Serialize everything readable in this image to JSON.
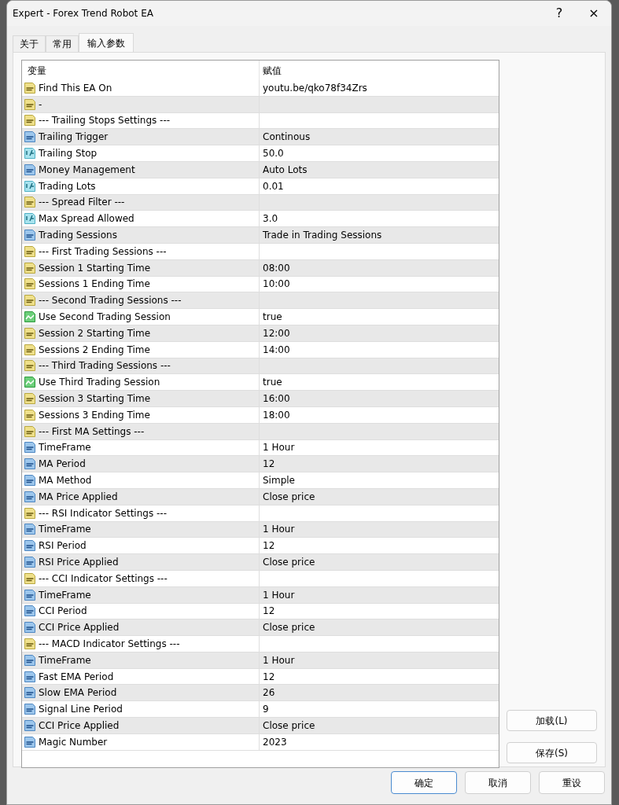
{
  "window": {
    "title": "Expert - Forex Trend Robot EA",
    "help": "?",
    "close": "×"
  },
  "tabs": [
    {
      "label": "关于",
      "selected": false
    },
    {
      "label": "常用",
      "selected": false
    },
    {
      "label": "输入参数",
      "selected": true
    }
  ],
  "table": {
    "columns": [
      "变量",
      "赋值"
    ],
    "rows": [
      {
        "kind": "string",
        "name": "Find This EA On",
        "value": "youtu.be/qko78f34Zrs"
      },
      {
        "kind": "string",
        "name": "-"
      },
      {
        "kind": "string",
        "name": "--- Trailing Stops Settings ---"
      },
      {
        "kind": "integer",
        "name": "Trailing Trigger",
        "value": "Continous"
      },
      {
        "kind": "double",
        "name": "Trailing Stop",
        "value": "50.0"
      },
      {
        "kind": "integer",
        "name": "Money Management",
        "value": "Auto Lots"
      },
      {
        "kind": "double",
        "name": "Trading Lots",
        "value": "0.01"
      },
      {
        "kind": "string",
        "name": "--- Spread Filter ---"
      },
      {
        "kind": "double",
        "name": "Max Spread Allowed",
        "value": "3.0"
      },
      {
        "kind": "integer",
        "name": "Trading Sessions",
        "value": "Trade in Trading Sessions"
      },
      {
        "kind": "string",
        "name": "--- First Trading Sessions ---"
      },
      {
        "kind": "string",
        "name": "Session 1 Starting Time",
        "value": "08:00"
      },
      {
        "kind": "string",
        "name": "Sessions 1 Ending Time",
        "value": "10:00"
      },
      {
        "kind": "string",
        "name": "--- Second Trading Sessions ---"
      },
      {
        "kind": "boolean",
        "name": "Use Second Trading Session",
        "value": "true"
      },
      {
        "kind": "string",
        "name": "Session 2 Starting Time",
        "value": "12:00"
      },
      {
        "kind": "string",
        "name": "Sessions 2 Ending Time",
        "value": "14:00"
      },
      {
        "kind": "string",
        "name": "--- Third Trading Sessions ---"
      },
      {
        "kind": "boolean",
        "name": "Use Third Trading Session",
        "value": "true"
      },
      {
        "kind": "string",
        "name": "Session 3 Starting Time",
        "value": "16:00"
      },
      {
        "kind": "string",
        "name": "Sessions 3 Ending Time",
        "value": "18:00"
      },
      {
        "kind": "string",
        "name": "--- First MA Settings ---"
      },
      {
        "kind": "integer",
        "name": "TimeFrame",
        "value": "1 Hour"
      },
      {
        "kind": "integer",
        "name": "MA Period",
        "value": "12"
      },
      {
        "kind": "integer",
        "name": "MA Method",
        "value": "Simple"
      },
      {
        "kind": "integer",
        "name": "MA Price Applied",
        "value": "Close price"
      },
      {
        "kind": "string",
        "name": "--- RSI Indicator Settings ---"
      },
      {
        "kind": "integer",
        "name": "TimeFrame",
        "value": "1 Hour"
      },
      {
        "kind": "integer",
        "name": "RSI Period",
        "value": "12"
      },
      {
        "kind": "integer",
        "name": "RSI Price Applied",
        "value": "Close price"
      },
      {
        "kind": "string",
        "name": "--- CCI Indicator Settings ---"
      },
      {
        "kind": "integer",
        "name": "TimeFrame",
        "value": "1 Hour"
      },
      {
        "kind": "integer",
        "name": "CCI Period",
        "value": "12"
      },
      {
        "kind": "integer",
        "name": "CCI Price Applied",
        "value": "Close price"
      },
      {
        "kind": "string",
        "name": "--- MACD Indicator Settings ---"
      },
      {
        "kind": "integer",
        "name": "TimeFrame",
        "value": "1 Hour"
      },
      {
        "kind": "integer",
        "name": "Fast EMA Period",
        "value": "12"
      },
      {
        "kind": "integer",
        "name": "Slow EMA Period",
        "value": "26"
      },
      {
        "kind": "integer",
        "name": "Signal Line Period",
        "value": "9"
      },
      {
        "kind": "integer",
        "name": "CCI Price Applied",
        "value": "Close price"
      },
      {
        "kind": "integer",
        "name": "Magic Number",
        "value": "2023"
      }
    ]
  },
  "side_buttons": [
    "加载(L)",
    "保存(S)"
  ],
  "buttons": [
    {
      "label": "确定",
      "default": true
    },
    {
      "label": "取消",
      "default": false
    },
    {
      "label": "重设",
      "default": false
    }
  ]
}
